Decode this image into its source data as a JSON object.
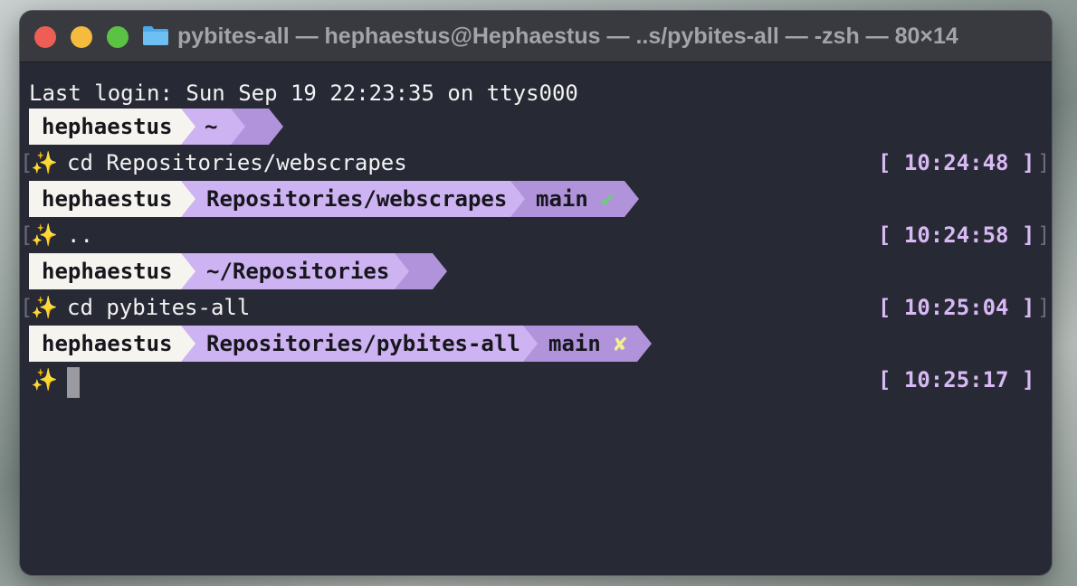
{
  "window": {
    "title": "pybites-all — hephaestus@Hephaestus — ..s/pybites-all — -zsh — 80×14"
  },
  "terminal": {
    "last_login": "Last login: Sun Sep 19 22:23:35 on ttys000",
    "prompts": [
      {
        "user": "hephaestus",
        "dir": "~",
        "git": "",
        "git_status": ""
      },
      {
        "user": "hephaestus",
        "dir": "Repositories/webscrapes",
        "git": "main",
        "git_status": "✔"
      },
      {
        "user": "hephaestus",
        "dir": "~/Repositories",
        "git": "",
        "git_status": ""
      },
      {
        "user": "hephaestus",
        "dir": "Repositories/pybites-all",
        "git": "main",
        "git_status": "✘"
      }
    ],
    "commands": [
      {
        "sparkle": "✨",
        "text": "cd Repositories/webscrapes",
        "time": "[ 10:24:48 ]",
        "open": "[",
        "close": "]"
      },
      {
        "sparkle": "✨",
        "text": "..",
        "time": "[ 10:24:58 ]",
        "open": "[",
        "close": "]"
      },
      {
        "sparkle": "✨",
        "text": "cd pybites-all",
        "time": "[ 10:25:04 ]",
        "open": "[",
        "close": "]"
      },
      {
        "sparkle": "✨",
        "text": "",
        "time": "[ 10:25:17 ]"
      }
    ]
  },
  "colors": {
    "background": "#272935",
    "segment_user": "#f6f4ef",
    "segment_dir": "#cdb3f1",
    "segment_git": "#b193db",
    "timestamp": "#d9b9f4"
  }
}
